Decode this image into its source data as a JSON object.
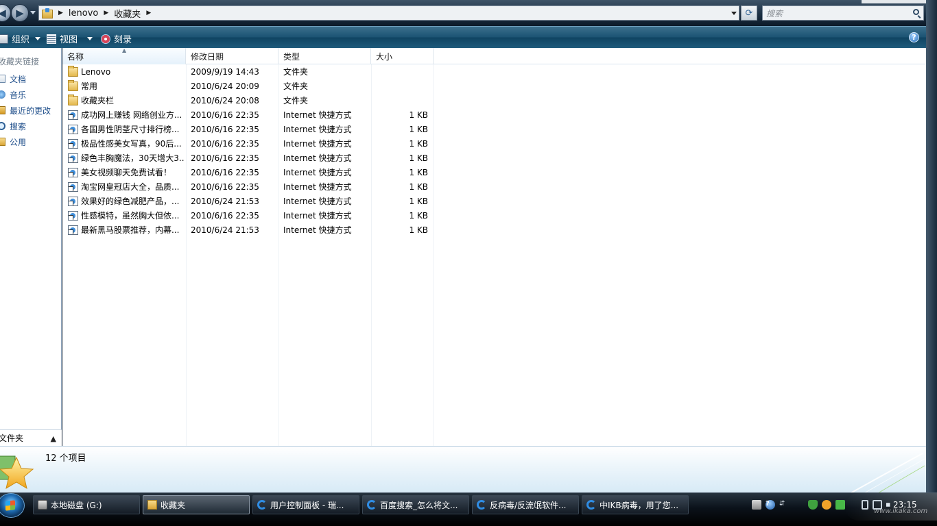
{
  "address_bar": {
    "crumbs": [
      "lenovo",
      "收藏夹"
    ],
    "search_placeholder": "搜索"
  },
  "command_bar": {
    "organize": "组织",
    "views": "视图",
    "burn": "刻录"
  },
  "nav_pane": {
    "header": "收藏夹链接",
    "links": [
      {
        "label": "文档",
        "icon": "document-icon"
      },
      {
        "label": "音乐",
        "icon": "music-icon"
      },
      {
        "label": "最近的更改",
        "icon": "recent-changes-icon"
      },
      {
        "label": "搜索",
        "icon": "search-icon"
      },
      {
        "label": "公用",
        "icon": "public-folder-icon"
      }
    ],
    "folders_label": "文件夹"
  },
  "columns": {
    "name": "名称",
    "date": "修改日期",
    "type": "类型",
    "size": "大小"
  },
  "files": [
    {
      "name": "Lenovo",
      "date": "2009/9/19 14:43",
      "type": "文件夹",
      "size": "",
      "kind": "folder"
    },
    {
      "name": "常用",
      "date": "2010/6/24 20:09",
      "type": "文件夹",
      "size": "",
      "kind": "folder"
    },
    {
      "name": "收藏夹栏",
      "date": "2010/6/24 20:08",
      "type": "文件夹",
      "size": "",
      "kind": "folder"
    },
    {
      "name": "成功网上赚钱 网络创业方...",
      "date": "2010/6/16 22:35",
      "type": "Internet 快捷方式",
      "size": "1 KB",
      "kind": "url"
    },
    {
      "name": "各国男性阴茎尺寸排行榜...",
      "date": "2010/6/16 22:35",
      "type": "Internet 快捷方式",
      "size": "1 KB",
      "kind": "url"
    },
    {
      "name": "极品性感美女写真，90后...",
      "date": "2010/6/16 22:35",
      "type": "Internet 快捷方式",
      "size": "1 KB",
      "kind": "url"
    },
    {
      "name": "绿色丰胸魔法，30天增大3...",
      "date": "2010/6/16 22:35",
      "type": "Internet 快捷方式",
      "size": "1 KB",
      "kind": "url"
    },
    {
      "name": "美女视频聊天免费试看！",
      "date": "2010/6/16 22:35",
      "type": "Internet 快捷方式",
      "size": "1 KB",
      "kind": "url"
    },
    {
      "name": "淘宝网皇冠店大全，品质...",
      "date": "2010/6/16 22:35",
      "type": "Internet 快捷方式",
      "size": "1 KB",
      "kind": "url"
    },
    {
      "name": "效果好的绿色减肥产品，...",
      "date": "2010/6/24 21:53",
      "type": "Internet 快捷方式",
      "size": "1 KB",
      "kind": "url"
    },
    {
      "name": "性感模特，虽然胸大但依...",
      "date": "2010/6/16 22:35",
      "type": "Internet 快捷方式",
      "size": "1 KB",
      "kind": "url"
    },
    {
      "name": "最新黑马股票推荐，内幕...",
      "date": "2010/6/24 21:53",
      "type": "Internet 快捷方式",
      "size": "1 KB",
      "kind": "url"
    }
  ],
  "details": {
    "item_count": "12 个项目"
  },
  "taskbar": {
    "tasks": [
      {
        "label": "本地磁盘 (G:)",
        "icon": "drive-icon",
        "active": false
      },
      {
        "label": "收藏夹",
        "icon": "folder-icon",
        "active": true
      },
      {
        "label": "用户控制面板 - 瑞...",
        "icon": "ie-icon",
        "active": false
      },
      {
        "label": "百度搜索_怎么将文...",
        "icon": "ie-icon",
        "active": false
      },
      {
        "label": "反病毒/反流氓软件...",
        "icon": "ie-icon",
        "active": false
      },
      {
        "label": "中IKB病毒，用了您...",
        "icon": "ie-icon",
        "active": false
      }
    ],
    "clock": "23:15",
    "watermark": "www.ikaka.com"
  }
}
